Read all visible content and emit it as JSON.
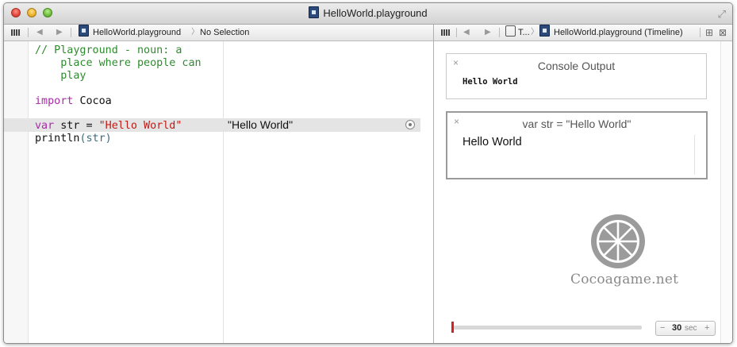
{
  "window": {
    "title": "HelloWorld.playground"
  },
  "editor_jumpbar": {
    "file": "HelloWorld.playground",
    "selection": "No Selection"
  },
  "timeline_jumpbar": {
    "group": "T...",
    "file": "HelloWorld.playground (Timeline)"
  },
  "code": {
    "comment_1": "// Playground - noun: a",
    "comment_2": "    place where people can",
    "comment_3": "    play",
    "import_kw": "import",
    "import_mod": "Cocoa",
    "var_kw": "var",
    "var_decl": "str = ",
    "var_value": "\"Hello World\"",
    "println_fn": "println",
    "println_args": "(str)"
  },
  "results": {
    "line_result": "\"Hello World\""
  },
  "console_card": {
    "title": "Console Output",
    "output": "Hello World",
    "close": "×"
  },
  "value_card": {
    "title": "var str = \"Hello World\"",
    "value": "Hello World",
    "close": "×"
  },
  "watermark": {
    "text": "Cocoagame.net"
  },
  "timeline_controls": {
    "minus": "−",
    "duration": "30",
    "unit": "sec",
    "plus": "+",
    "position": 0.0
  },
  "colors": {
    "comment": "#2e8b2e",
    "keyword": "#aa2aa8",
    "string": "#c41a16",
    "slider_thumb": "#d42020"
  },
  "icons": [
    "grid-menu-icon",
    "back-arrow-icon",
    "forward-arrow-icon",
    "playground-file-icon",
    "result-circle-icon",
    "close-icon",
    "fullscreen-icon"
  ]
}
